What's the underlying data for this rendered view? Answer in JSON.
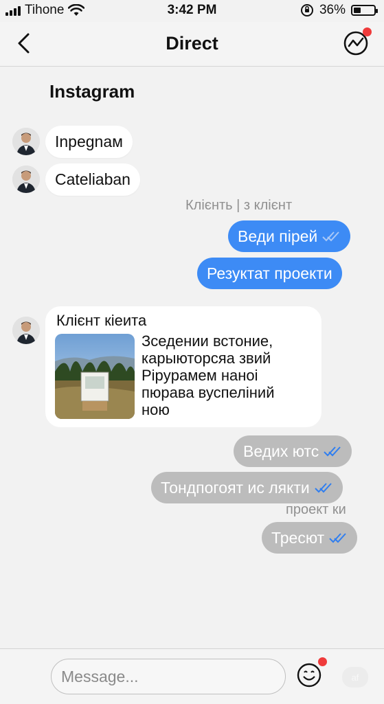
{
  "status_bar": {
    "carrier": "Tihone",
    "time": "3:42 PM",
    "battery_percent": "36%",
    "battery_level": 0.36
  },
  "nav": {
    "title": "Direct"
  },
  "section_title": "Instagram",
  "messages": [
    {
      "type": "incoming",
      "text": "Inpegnaм"
    },
    {
      "type": "incoming",
      "text": "Cateliaban"
    },
    {
      "type": "caption",
      "text": "Клієнть | з клієнт"
    },
    {
      "type": "outgoing",
      "text": "Веди пірей"
    },
    {
      "type": "outgoing",
      "text": "Резуктат проекти"
    },
    {
      "type": "card",
      "title": "Клієнт кіеита",
      "lines": [
        "Зседении встоние,",
        "карыюторсяа звий",
        "Pipyрамем наноі",
        "пюрава вуспеліний",
        "ною"
      ]
    },
    {
      "type": "outgoing-gray",
      "text": "Ведих ютс"
    },
    {
      "type": "outgoing-gray",
      "text": "Тондпогоят ис лякти"
    },
    {
      "type": "caption",
      "text": "проект ки"
    },
    {
      "type": "outgoing-gray",
      "text": "Тресют"
    }
  ],
  "composer": {
    "placeholder": "Message...",
    "ghost_label": "af"
  },
  "colors": {
    "blue_bubble": "#3d8bf5",
    "gray_bubble": "#bcbcbc",
    "check_blue": "#2f7ef0",
    "badge_red": "#ef3b3b"
  }
}
